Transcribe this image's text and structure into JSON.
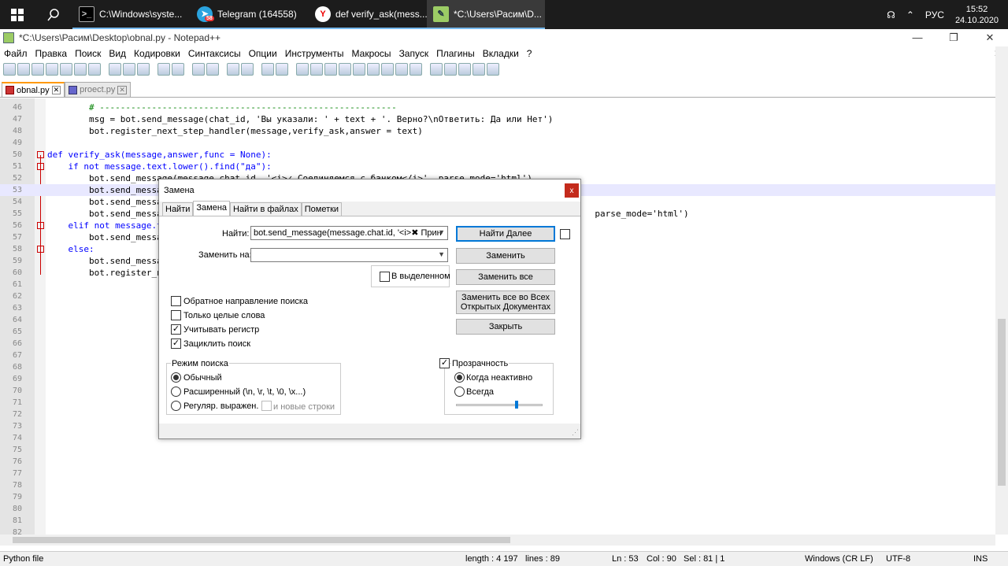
{
  "taskbar": {
    "tasks": [
      {
        "label": "C:\\Windows\\syste...",
        "icon": "cmd-icon"
      },
      {
        "label": "Telegram (164558)",
        "icon": "telegram-icon",
        "badge": "58"
      },
      {
        "label": "def verify_ask(mess...",
        "icon": "yandex-browser-icon"
      },
      {
        "label": "*C:\\Users\\Расим\\D...",
        "icon": "notepadpp-icon"
      }
    ],
    "lang": "РУС",
    "time": "15:52",
    "date": "24.10.2020"
  },
  "window": {
    "title": "*C:\\Users\\Расим\\Desktop\\obnal.py - Notepad++",
    "minimize": "—",
    "maximize": "❐",
    "close": "✕"
  },
  "menu": [
    "Файл",
    "Правка",
    "Поиск",
    "Вид",
    "Кодировки",
    "Синтаксисы",
    "Опции",
    "Инструменты",
    "Макросы",
    "Запуск",
    "Плагины",
    "Вкладки",
    "?"
  ],
  "menu_close": "✕",
  "file_tabs": [
    {
      "label": "obnal.py",
      "close": "✕"
    },
    {
      "label": "proect.py",
      "close": "✕"
    }
  ],
  "editor": {
    "lines": [
      {
        "n": "46",
        "text": "        # ---------------------------------------------------------"
      },
      {
        "n": "47",
        "text": "        msg = bot.send_message(chat_id, 'Вы указали: ' + text + '. Верно?\\nОтветить: Да или Нет')"
      },
      {
        "n": "48",
        "text": "        bot.register_next_step_handler(message,verify_ask,answer = text)"
      },
      {
        "n": "49",
        "text": ""
      },
      {
        "n": "50",
        "text": "def verify_ask(message,answer,func = None):"
      },
      {
        "n": "51",
        "text": "    if not message.text.lower().find(\"да\"):"
      },
      {
        "n": "52",
        "text": "        bot.send_message(message.chat.id, '<i>✓ Соединяемся с банком</i>', parse_mode='html')"
      },
      {
        "n": "53",
        "text": "        bot.send_messa"
      },
      {
        "n": "54",
        "text": "        bot.send_messa"
      },
      {
        "n": "55",
        "text": "        bot.send_messa                                                                                   parse_mode='html')"
      },
      {
        "n": "56",
        "text": "    elif not message.t"
      },
      {
        "n": "57",
        "text": "        bot.send_messa"
      },
      {
        "n": "58",
        "text": "    else:"
      },
      {
        "n": "59",
        "text": "        bot.send_messa"
      },
      {
        "n": "60",
        "text": "        bot.register_n"
      },
      {
        "n": "61",
        "text": ""
      },
      {
        "n": "62",
        "text": ""
      },
      {
        "n": "63",
        "text": ""
      },
      {
        "n": "64",
        "text": ""
      },
      {
        "n": "65",
        "text": ""
      },
      {
        "n": "66",
        "text": ""
      },
      {
        "n": "67",
        "text": ""
      },
      {
        "n": "68",
        "text": ""
      },
      {
        "n": "69",
        "text": ""
      },
      {
        "n": "70",
        "text": ""
      },
      {
        "n": "71",
        "text": ""
      },
      {
        "n": "72",
        "text": ""
      },
      {
        "n": "73",
        "text": ""
      },
      {
        "n": "74",
        "text": ""
      },
      {
        "n": "75",
        "text": ""
      },
      {
        "n": "76",
        "text": ""
      },
      {
        "n": "77",
        "text": ""
      },
      {
        "n": "78",
        "text": ""
      },
      {
        "n": "79",
        "text": ""
      },
      {
        "n": "80",
        "text": ""
      },
      {
        "n": "81",
        "text": ""
      },
      {
        "n": "82",
        "text": ""
      }
    ]
  },
  "status": {
    "lang": "Python file",
    "length": "length : 4 197",
    "lines": "lines : 89",
    "ln": "Ln : 53",
    "col": "Col : 90",
    "sel": "Sel : 81 | 1",
    "eol": "Windows (CR LF)",
    "encoding": "UTF-8",
    "mode": "INS"
  },
  "dialog": {
    "title": "Замена",
    "close": "x",
    "tabs": [
      "Найти",
      "Замена",
      "Найти в файлах",
      "Пометки"
    ],
    "find_label": "Найти:",
    "find_value": "bot.send_message(message.chat.id, '<i>✖ Прин",
    "replace_label": "Заменить на:",
    "replace_value": "",
    "in_selection": "В выделенном",
    "buttons": {
      "find_next": "Найти Далее",
      "replace": "Заменить",
      "replace_all": "Заменить все",
      "replace_all_open_1": "Заменить все во Всех",
      "replace_all_open_2": "Открытых Документах",
      "close": "Закрыть"
    },
    "options": {
      "backward": "Обратное направление поиска",
      "whole_word": "Только целые слова",
      "match_case": "Учитывать регистр",
      "wrap": "Зациклить поиск"
    },
    "search_mode": {
      "title": "Режим поиска",
      "normal": "Обычный",
      "extended": "Расширенный (\\n, \\r, \\t, \\0, \\x...)",
      "regex": "Регуляр. выражен.",
      "newlines": "и новые строки"
    },
    "transparency": {
      "title": "Прозрачность",
      "when_inactive": "Когда неактивно",
      "always": "Всегда",
      "level": 0.7
    }
  }
}
